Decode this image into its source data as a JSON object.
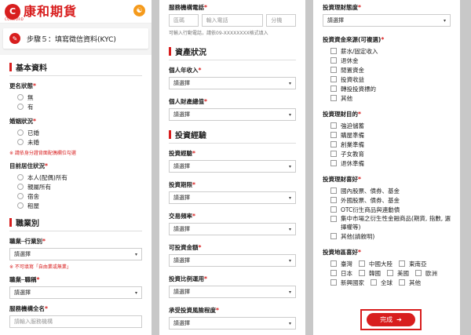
{
  "brand": {
    "name": "康和期貨",
    "sub": "CONCORD",
    "mark": "C"
  },
  "step": {
    "title": "步驟５：填寫徵信資料(KYC)"
  },
  "p1": {
    "basic_title": "基本資料",
    "rename_label": "更名狀態",
    "rename_opts": [
      "無",
      "有"
    ],
    "marital_label": "婚姻狀況",
    "marital_opts": [
      "已婚",
      "未婚"
    ],
    "marital_note": "※ 請依身分證背面配偶欄位勾選",
    "residence_label": "目前居住狀況",
    "residence_opts": [
      "本人(配偶)所有",
      "親屬所有",
      "宿舍",
      "租屋"
    ],
    "job_title": "職業別",
    "industry_label": "職業─行業別",
    "industry_value": "請選擇",
    "industry_note": "※ 不可填寫「自由業或無業」",
    "position_label": "職業─職稱",
    "position_value": "請選擇",
    "employer_label": "服務機構全名",
    "employer_placeholder": "請輸入服務機構"
  },
  "p2": {
    "phone_label": "服務機構電話",
    "area_ph": "區碼",
    "phone_ph": "輸入電話",
    "ext_ph": "分機",
    "phone_hint": "可輸入行動電話，請依09-XXXXXXXX格式填入",
    "assets_title": "資產狀況",
    "income_label": "個人年收入",
    "income_value": "請選擇",
    "wealth_label": "個人財產總值",
    "wealth_value": "請選擇",
    "exp_title": "投資經驗",
    "exp_label": "投資經驗",
    "exp_value": "請選擇",
    "period_label": "投資期限",
    "period_value": "請選擇",
    "freq_label": "交易頻率",
    "freq_value": "請選擇",
    "amount_label": "可投資金額",
    "amount_value": "請選擇",
    "ratio_label": "投資比例運用",
    "ratio_value": "請選擇",
    "risk_label": "承受投資風險程度",
    "risk_value": "請選擇"
  },
  "p3": {
    "attitude_label": "投資理財態度",
    "attitude_value": "請選擇",
    "source_label": "投資資金來源(可複選)",
    "source_opts": [
      "薪水/固定收入",
      "退休金",
      "閒置資金",
      "投資收益",
      "轉投投資標的",
      "其他"
    ],
    "purpose_label": "投資理財目的",
    "purpose_opts": [
      "強迫儲蓄",
      "購屋準備",
      "創業準備",
      "子女教育",
      "退休準備"
    ],
    "pref_label": "投資理財喜好",
    "pref_opts": [
      "國內股票、債券、基金",
      "外國股票、債券、基金",
      "OTC衍生商品與連動債",
      "集中市場之衍生性金融商品(期貨, 指數, 選擇權等)",
      "其他(請敘明)"
    ],
    "region_label": "投資地區喜好",
    "region_opts": [
      "臺灣",
      "中國大陸",
      "東南亞",
      "日本",
      "韓國",
      "美國",
      "歐洲",
      "新興國家",
      "全球",
      "其他"
    ],
    "submit_label": "完成",
    "submit_arrow": "➔"
  },
  "required_mark": "*"
}
